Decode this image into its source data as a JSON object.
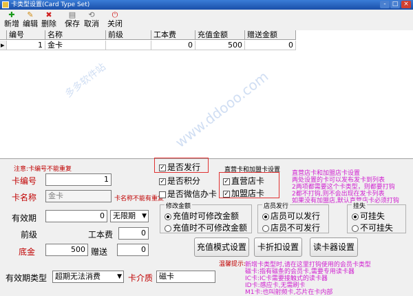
{
  "window": {
    "title": "卡类型设置(Card Type Set)",
    "controls": [
      "-",
      "□",
      "×"
    ]
  },
  "toolbar": {
    "items": [
      {
        "label": "新增",
        "icon": "add-icon"
      },
      {
        "label": "编辑",
        "icon": "edit-icon"
      },
      {
        "label": "删除",
        "icon": "delete-icon"
      },
      {
        "label": "保存",
        "icon": "save-icon"
      },
      {
        "label": "取消",
        "icon": "cancel-icon"
      },
      {
        "label": "关闭",
        "icon": "close-icon"
      }
    ]
  },
  "grid": {
    "columns": [
      "编号",
      "名称",
      "前级",
      "工本费",
      "充值金额",
      "赠送金额"
    ],
    "rows": [
      {
        "indicator": "▸",
        "no": "1",
        "name": "金卡",
        "prev": "",
        "fee": "0",
        "charge": "500",
        "gift": "0"
      }
    ]
  },
  "form": {
    "note": "注意:卡编号不能重复",
    "name_note": "卡名称不能有重复",
    "card_no_label": "卡编号",
    "card_no_value": "1",
    "card_name_label": "卡名称",
    "card_name_value": "金卡",
    "validity_label": "有效期",
    "validity_value": "0",
    "validity_unit": "无限期",
    "prev_label": "前级",
    "fee_label": "工本费",
    "fee_value": "0",
    "base_label": "底金",
    "base_value": "500",
    "gift_label": "赠送",
    "gift_value": "0",
    "validity_type_label": "有效期类型",
    "validity_type_value": "超期无法消费",
    "medium_label": "卡介质",
    "medium_value": "磁卡"
  },
  "options": {
    "issue": {
      "label": "是否发行",
      "checked": true
    },
    "points": {
      "label": "是否积分",
      "checked": true
    },
    "wechat": {
      "label": "是否微信办卡",
      "checked": false
    },
    "direct": {
      "label": "直营店卡",
      "checked": true
    },
    "franchise": {
      "label": "加盟店卡",
      "checked": true
    },
    "store_type_title": "直营卡和加盟卡设置"
  },
  "groups": {
    "modify": {
      "title": "修改金额",
      "opt1": "充值时可修改金额",
      "opt2": "充值时不可修改金额",
      "selected": 1
    },
    "clerk": {
      "title": "店员发行",
      "opt1": "店员可以发行",
      "opt2": "店员不可发行",
      "selected": 1
    },
    "suspend": {
      "title": "挂失",
      "opt1": "可挂失",
      "opt2": "不可挂失",
      "selected": 1
    }
  },
  "buttons": {
    "charge_mode": "充值模式设置",
    "discount": "卡折扣设置",
    "reader": "读卡器设置"
  },
  "hints": {
    "store": [
      "直营店卡和加盟店卡设置",
      "两处设置的卡可以发布发卡到列表",
      "2两项都需要这个卡类型，则都要打钩",
      "2都不打钩,则不会出现在发卡列表",
      "如果没有加盟店,默认直营店卡必须打钩"
    ],
    "bottom_title": "温馨提示:",
    "bottom": [
      "新增卡类型时,请在这里打钩使用的会员卡类型",
      "磁卡:指有磁条的会员卡,需要专用读卡器",
      "IC卡:IC卡需要接触式的读卡器",
      "ID卡:感应卡,无需刷卡",
      "M1卡:也叫射频卡,芯片在卡内部"
    ]
  },
  "watermarks": [
    "www.ddooo.com",
    "多多软件站"
  ],
  "colors": {
    "title_bar": "#1a4fa8",
    "note": "#c00000",
    "hint": "#d020d0",
    "highlight_box": "#e03030"
  }
}
